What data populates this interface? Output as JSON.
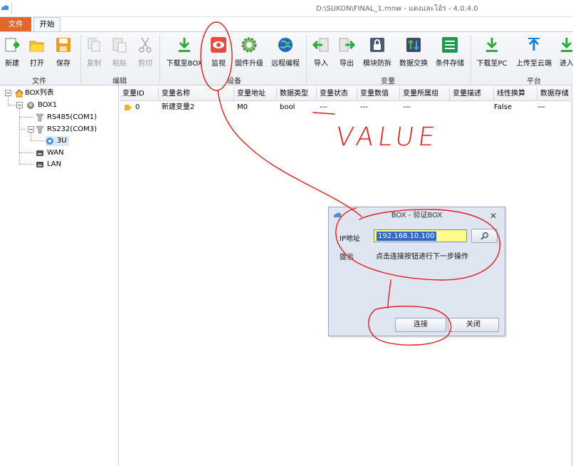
{
  "window": {
    "title": "D:\\SUKON\\FINAL_1.mnw - แดงและโอ้ร - 4.0.4.0"
  },
  "ribbon": {
    "tabs": [
      {
        "label": "文件"
      },
      {
        "label": "开始"
      }
    ],
    "groups": {
      "file": {
        "label": "文件",
        "buttons": [
          {
            "label": "新建",
            "icon": "new-icon"
          },
          {
            "label": "打开",
            "icon": "open-folder-icon"
          },
          {
            "label": "保存",
            "icon": "save-icon"
          }
        ]
      },
      "edit": {
        "label": "编辑",
        "buttons": [
          {
            "label": "复制",
            "icon": "copy-icon",
            "disabled": true
          },
          {
            "label": "粘贴",
            "icon": "paste-icon",
            "disabled": true
          },
          {
            "label": "剪切",
            "icon": "cut-icon",
            "disabled": true
          }
        ]
      },
      "device": {
        "label": "设备",
        "buttons": [
          {
            "label": "下载至BOX",
            "icon": "download-icon"
          },
          {
            "label": "监视",
            "icon": "eye-icon"
          },
          {
            "label": "固件升级",
            "icon": "gear-icon"
          },
          {
            "label": "远程编程",
            "icon": "globe-icon"
          }
        ]
      },
      "variable": {
        "label": "变量",
        "buttons": [
          {
            "label": "导入",
            "icon": "import-icon"
          },
          {
            "label": "导出",
            "icon": "export-icon"
          },
          {
            "label": "模块防拆",
            "icon": "lock-icon"
          },
          {
            "label": "数据交换",
            "icon": "exchange-icon"
          },
          {
            "label": "条件存储",
            "icon": "list-icon"
          }
        ]
      },
      "platform": {
        "label": "平台",
        "buttons": [
          {
            "label": "下载至PC",
            "icon": "download-icon"
          },
          {
            "label": "上传至云端",
            "icon": "upload-icon"
          },
          {
            "label": "进入",
            "icon": "enter-icon"
          }
        ]
      }
    }
  },
  "tree": {
    "root": "BOX列表",
    "box": "BOX1",
    "rs485": "RS485(COM1)",
    "rs232": "RS232(COM3)",
    "device3u": "3U",
    "wan": "WAN",
    "lan": "LAN"
  },
  "grid": {
    "columns": [
      "变量ID",
      "变量名称",
      "变量地址",
      "数据类型",
      "变量状态",
      "变量数值",
      "变量所属组",
      "变量描述",
      "线性换算",
      "数据存储"
    ],
    "rows": [
      {
        "id": "0",
        "name": "新建变量2",
        "address": "M0",
        "type": "bool",
        "status": "---",
        "value": "---",
        "group": "---",
        "desc": "",
        "linear": "False",
        "storage": "---"
      }
    ]
  },
  "dialog": {
    "title": "BOX - 验证BOX",
    "ip_label": "IP地址",
    "ip_value": "192.168.10.100",
    "hint_label": "提示",
    "hint_text": "点击连接按钮进行下一步操作",
    "connect_label": "连接",
    "close_label": "关闭"
  },
  "annotation": {
    "text": "VALUE",
    "color": "#e21b1b"
  }
}
